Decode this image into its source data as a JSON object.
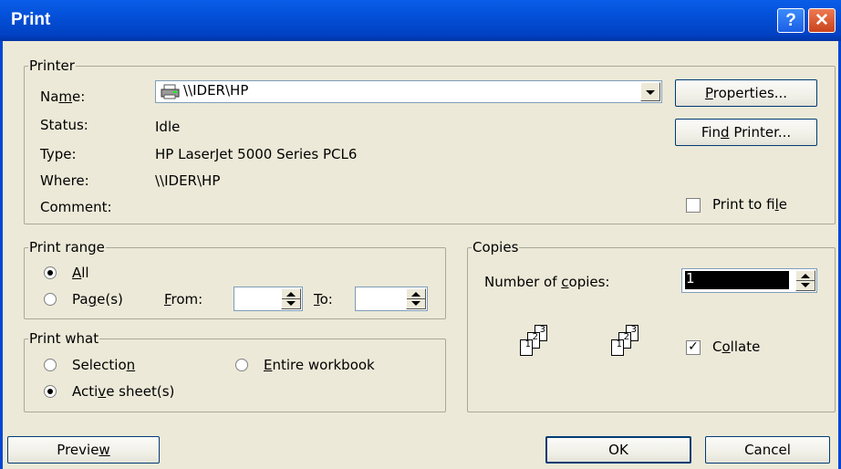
{
  "window": {
    "title": "Print",
    "help_glyph": "?",
    "close_glyph": "✕"
  },
  "printer": {
    "legend": "Printer",
    "name_label": "Name:",
    "name_value": "\\\\IDER\\HP",
    "status_label": "Status:",
    "status_value": "Idle",
    "type_label": "Type:",
    "type_value": "HP LaserJet 5000 Series PCL6",
    "where_label": "Where:",
    "where_value": "\\\\IDER\\HP",
    "comment_label": "Comment:",
    "properties_button": "Properties...",
    "find_printer_button": "Find Printer...",
    "print_to_file_label": "Print to file",
    "print_to_file_checked": false
  },
  "print_range": {
    "legend": "Print range",
    "all_label": "All",
    "pages_label": "Page(s)",
    "from_label": "From:",
    "to_label": "To:",
    "from_value": "",
    "to_value": "",
    "selected": "All"
  },
  "print_what": {
    "legend": "Print what",
    "selection_label": "Selection",
    "entire_workbook_label": "Entire workbook",
    "active_sheets_label": "Active sheet(s)",
    "selected": "Active sheet(s)"
  },
  "copies": {
    "legend": "Copies",
    "number_label": "Number of copies:",
    "number_value": "1",
    "collate_label": "Collate",
    "collate_checked": true,
    "page_numbers": [
      "1",
      "2",
      "3"
    ]
  },
  "footer": {
    "preview_button": "Preview",
    "ok_button": "OK",
    "cancel_button": "Cancel"
  },
  "colors": {
    "titlebar": "#0350d8",
    "dialog_bg": "#ece9d8",
    "frame_border": "#aca899"
  }
}
